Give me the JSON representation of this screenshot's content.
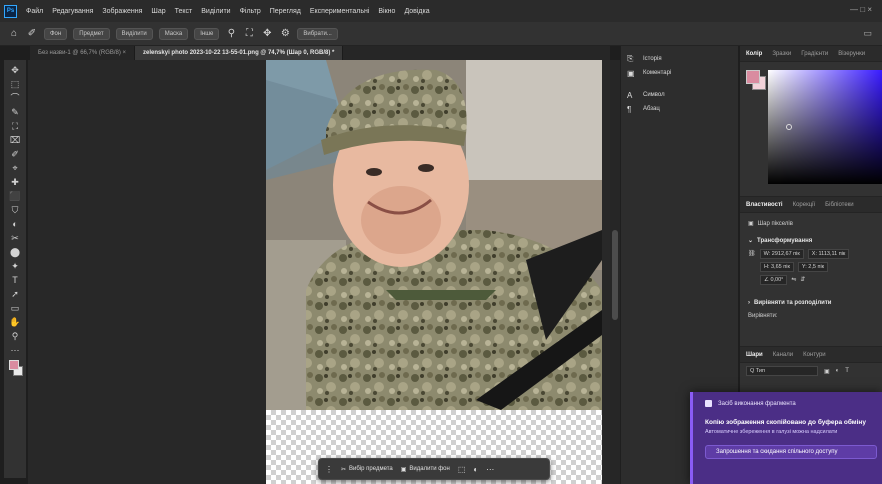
{
  "app": {
    "logo_text": "Ps",
    "menus": [
      "Файл",
      "Редагування",
      "Зображення",
      "Шар",
      "Текст",
      "Виділити",
      "Фільтр",
      "Перегляд",
      "Експериментальні",
      "Вікно",
      "Довідка"
    ],
    "window_controls": "— □ ×"
  },
  "options_bar": {
    "buttons": [
      "Фон",
      "Предмет",
      "Виділити",
      "Маска",
      "Інше"
    ],
    "extra_label": "Вибрати..."
  },
  "tabs": [
    {
      "label": "Без назви-1 @ 66,7% (RGB/8) ×",
      "active": false
    },
    {
      "label": "zelenskyi photo 2023-10-22 13-55-01.png @ 74,7% (Шар 0, RGB/8) *",
      "active": true
    }
  ],
  "tools": [
    "✥",
    "⬚",
    "⌒",
    "✎",
    "⛶",
    "⌧",
    "✐",
    "⌖",
    "✚",
    "⬛",
    "⛉",
    "◐",
    "✂",
    "⬤",
    "✦",
    "T",
    "➚",
    "▭",
    "✋",
    "⚲",
    "⋯"
  ],
  "mid_panel": {
    "items": [
      {
        "icon": "⎘",
        "label": "Історія"
      },
      {
        "icon": "▣",
        "label": "Коментарі"
      },
      {
        "icon": "A",
        "label": "Символ"
      },
      {
        "icon": "¶",
        "label": "Абзац"
      }
    ]
  },
  "color_panel": {
    "tabs": [
      "Колір",
      "Зразки",
      "Градієнти",
      "Візерунки"
    ],
    "active_tab": "Колір",
    "foreground": "#d98ca0",
    "background": "#f2d3da"
  },
  "properties": {
    "tabs": [
      "Властивості",
      "Корекції",
      "Бібліотеки"
    ],
    "layer_type": "Шар пікселів",
    "transform_title": "Трансформування",
    "w": "W: 2912,67 пік",
    "x": "X: 1113,11 пік",
    "h": "H: 3,65 пік",
    "y": "Y: 2,5 пік",
    "angle": "∠ 0,00°",
    "align_title": "Вирівняти та розподілити",
    "align_sub": "Вирівняти:"
  },
  "layers": {
    "tabs": [
      "Шари",
      "Канали",
      "Контури"
    ],
    "search": "Q Тип"
  },
  "context_bar": {
    "select_subject": "Вибір предмета",
    "remove_bg": "Видалити фон",
    "more": "⋯"
  },
  "toast": {
    "title": "Засіб виконання фрагмента",
    "heading": "Копію зображення скопійовано до буфера обміну",
    "subtext": "Автоматичне збереження в галузі можна надсилати",
    "button": "Запрошення та скидання спільного доступу"
  }
}
